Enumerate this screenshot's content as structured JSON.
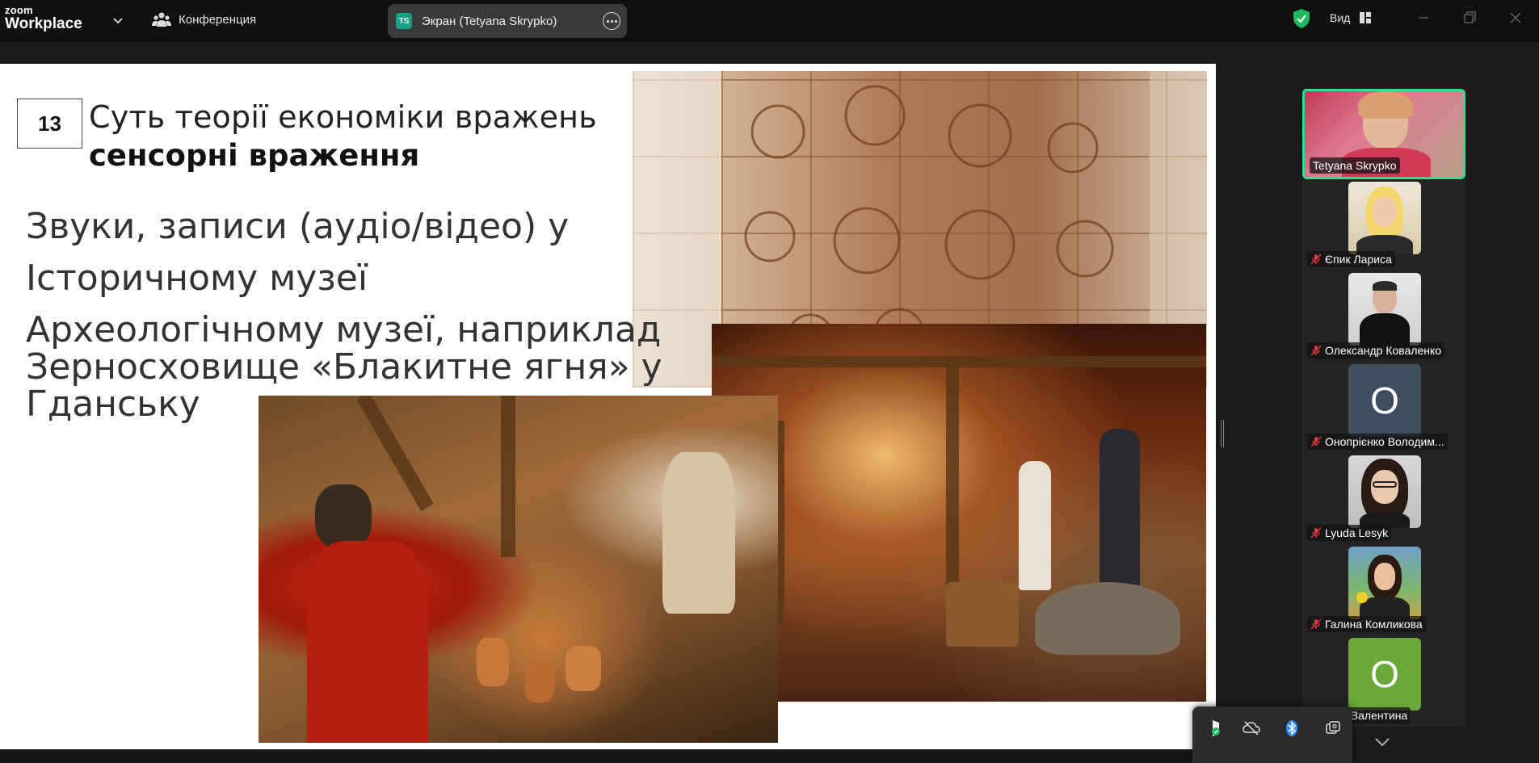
{
  "app": {
    "brand_top": "zoom",
    "brand_bottom": "Workplace",
    "meeting_label": "Конференция",
    "share_badge": "TS",
    "share_label": "Экран (Tetyana Skrypko)",
    "view_label": "Вид"
  },
  "slide": {
    "number": "13",
    "title": "Суть теорії економіки вражень",
    "subtitle": "сенсорні враження",
    "lines": [
      "Звуки, записи (аудіо/відео) у",
      "Історичному музеї",
      "Археологічному музеї, наприклад",
      "Зерносховище «Блакитне ягня» у",
      "Гданську"
    ]
  },
  "participants": [
    {
      "name": "Tetyana Skrypko",
      "avatar": "photo",
      "muted": false,
      "active": true
    },
    {
      "name": "Єпик Лариса",
      "avatar": "photo",
      "muted": true,
      "active": false
    },
    {
      "name": "Олександр Коваленко",
      "avatar": "photo",
      "muted": true,
      "active": false
    },
    {
      "name": "Онопрієнко Володим...",
      "avatar": "О",
      "muted": true,
      "active": false
    },
    {
      "name": "Lyuda Lesyk",
      "avatar": "photo",
      "muted": true,
      "active": false
    },
    {
      "name": "Галина Комликова",
      "avatar": "photo",
      "muted": true,
      "active": false
    },
    {
      "name": "Папчук Валентина",
      "avatar": "О",
      "muted": false,
      "active": false
    }
  ],
  "colors": {
    "active_border": "#2ee08a",
    "shield_green": "#1fb85a",
    "avatar_teal": "#3d4f5c",
    "avatar_green": "#6aa83a",
    "bluetooth": "#2f8fff"
  }
}
